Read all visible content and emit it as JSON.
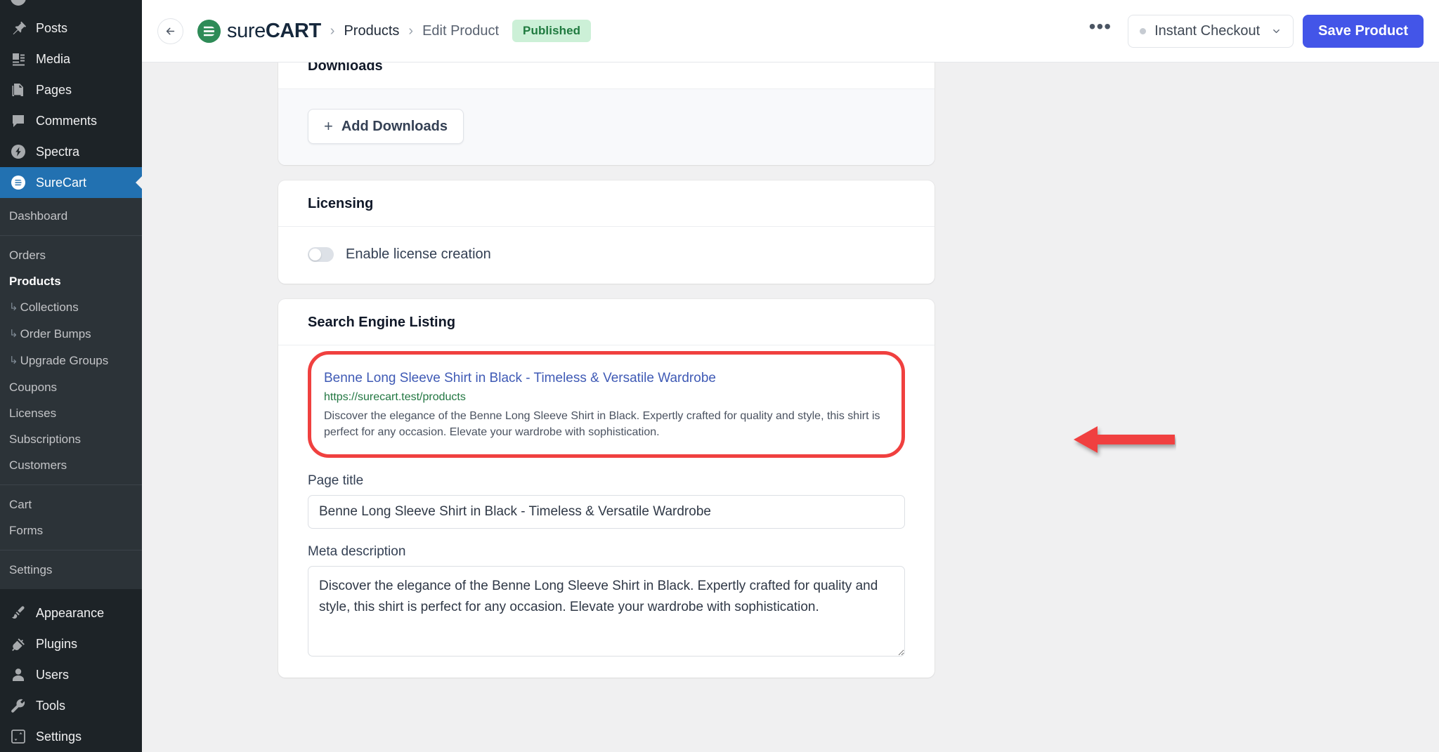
{
  "wp_sidebar": {
    "items": [
      {
        "label": "Posts",
        "icon": "pin-icon",
        "active": false
      },
      {
        "label": "Media",
        "icon": "media-icon",
        "active": false
      },
      {
        "label": "Pages",
        "icon": "pages-icon",
        "active": false
      },
      {
        "label": "Comments",
        "icon": "comments-icon",
        "active": false
      },
      {
        "label": "Spectra",
        "icon": "spectra-icon",
        "active": false
      },
      {
        "label": "SureCart",
        "icon": "surecart-icon",
        "active": true
      }
    ],
    "submenu_group_1": [
      {
        "label": "Dashboard",
        "current": false,
        "child": false
      }
    ],
    "submenu_group_2": [
      {
        "label": "Orders",
        "current": false,
        "child": false
      },
      {
        "label": "Products",
        "current": true,
        "child": false
      },
      {
        "label": "Collections",
        "current": false,
        "child": true
      },
      {
        "label": "Order Bumps",
        "current": false,
        "child": true
      },
      {
        "label": "Upgrade Groups",
        "current": false,
        "child": true
      },
      {
        "label": "Coupons",
        "current": false,
        "child": false
      },
      {
        "label": "Licenses",
        "current": false,
        "child": false
      },
      {
        "label": "Subscriptions",
        "current": false,
        "child": false
      },
      {
        "label": "Customers",
        "current": false,
        "child": false
      }
    ],
    "submenu_group_3": [
      {
        "label": "Cart",
        "current": false,
        "child": false
      },
      {
        "label": "Forms",
        "current": false,
        "child": false
      }
    ],
    "submenu_group_4": [
      {
        "label": "Settings",
        "current": false,
        "child": false
      }
    ],
    "bottom_items": [
      {
        "label": "Appearance",
        "icon": "paintbrush-icon"
      },
      {
        "label": "Plugins",
        "icon": "plug-icon"
      },
      {
        "label": "Users",
        "icon": "user-icon"
      },
      {
        "label": "Tools",
        "icon": "wrench-icon"
      },
      {
        "label": "Settings",
        "icon": "sliders-icon"
      }
    ],
    "child_prefix_glyph": "↳"
  },
  "topbar": {
    "back_icon": "arrow-left-icon",
    "brand_sure": "sure",
    "brand_cart": "CART",
    "breadcrumb_sep": "›",
    "breadcrumbs": [
      {
        "label": "Products"
      },
      {
        "label": "Edit Product"
      }
    ],
    "status_badge": "Published",
    "kebab": "•••",
    "checkout_select_value": "Instant Checkout",
    "chevron_icon": "chevron-down-icon",
    "save_label": "Save Product"
  },
  "cards": {
    "downloads": {
      "title": "Downloads",
      "add_button": "Add Downloads",
      "plus_glyph": "+"
    },
    "licensing": {
      "title": "Licensing",
      "toggle_label": "Enable license creation",
      "toggle_on": false
    },
    "seo": {
      "title": "Search Engine Listing",
      "preview": {
        "title": "Benne Long Sleeve Shirt in Black - Timeless & Versatile Wardrobe",
        "url": "https://surecart.test/products",
        "description": "Discover the elegance of the Benne Long Sleeve Shirt in Black. Expertly crafted for quality and style, this shirt is perfect for any occasion. Elevate your wardrobe with sophistication."
      },
      "page_title_label": "Page title",
      "page_title_value": "Benne Long Sleeve Shirt in Black - Timeless & Versatile Wardrobe",
      "meta_description_label": "Meta description",
      "meta_description_value": "Discover the elegance of the Benne Long Sleeve Shirt in Black. Expertly crafted for quality and style, this shirt is perfect for any occasion. Elevate your wardrobe with sophistication."
    }
  },
  "annotations": {
    "highlight_color": "#f0403f",
    "arrow_color": "#f0403f",
    "arrow_direction": "left",
    "target": "search-engine-listing-preview"
  },
  "colors": {
    "sidebar_bg": "#1d2327",
    "sidebar_submenu_bg": "#2c3338",
    "sidebar_active": "#2271b1",
    "page_bg": "#f0f0f1",
    "brand_green": "#2e8b57",
    "save_blue": "#4355e8",
    "badge_bg": "#ccf0d7",
    "badge_text": "#1f7a3f",
    "serp_title": "#3f5ab5",
    "serp_url": "#227742"
  }
}
